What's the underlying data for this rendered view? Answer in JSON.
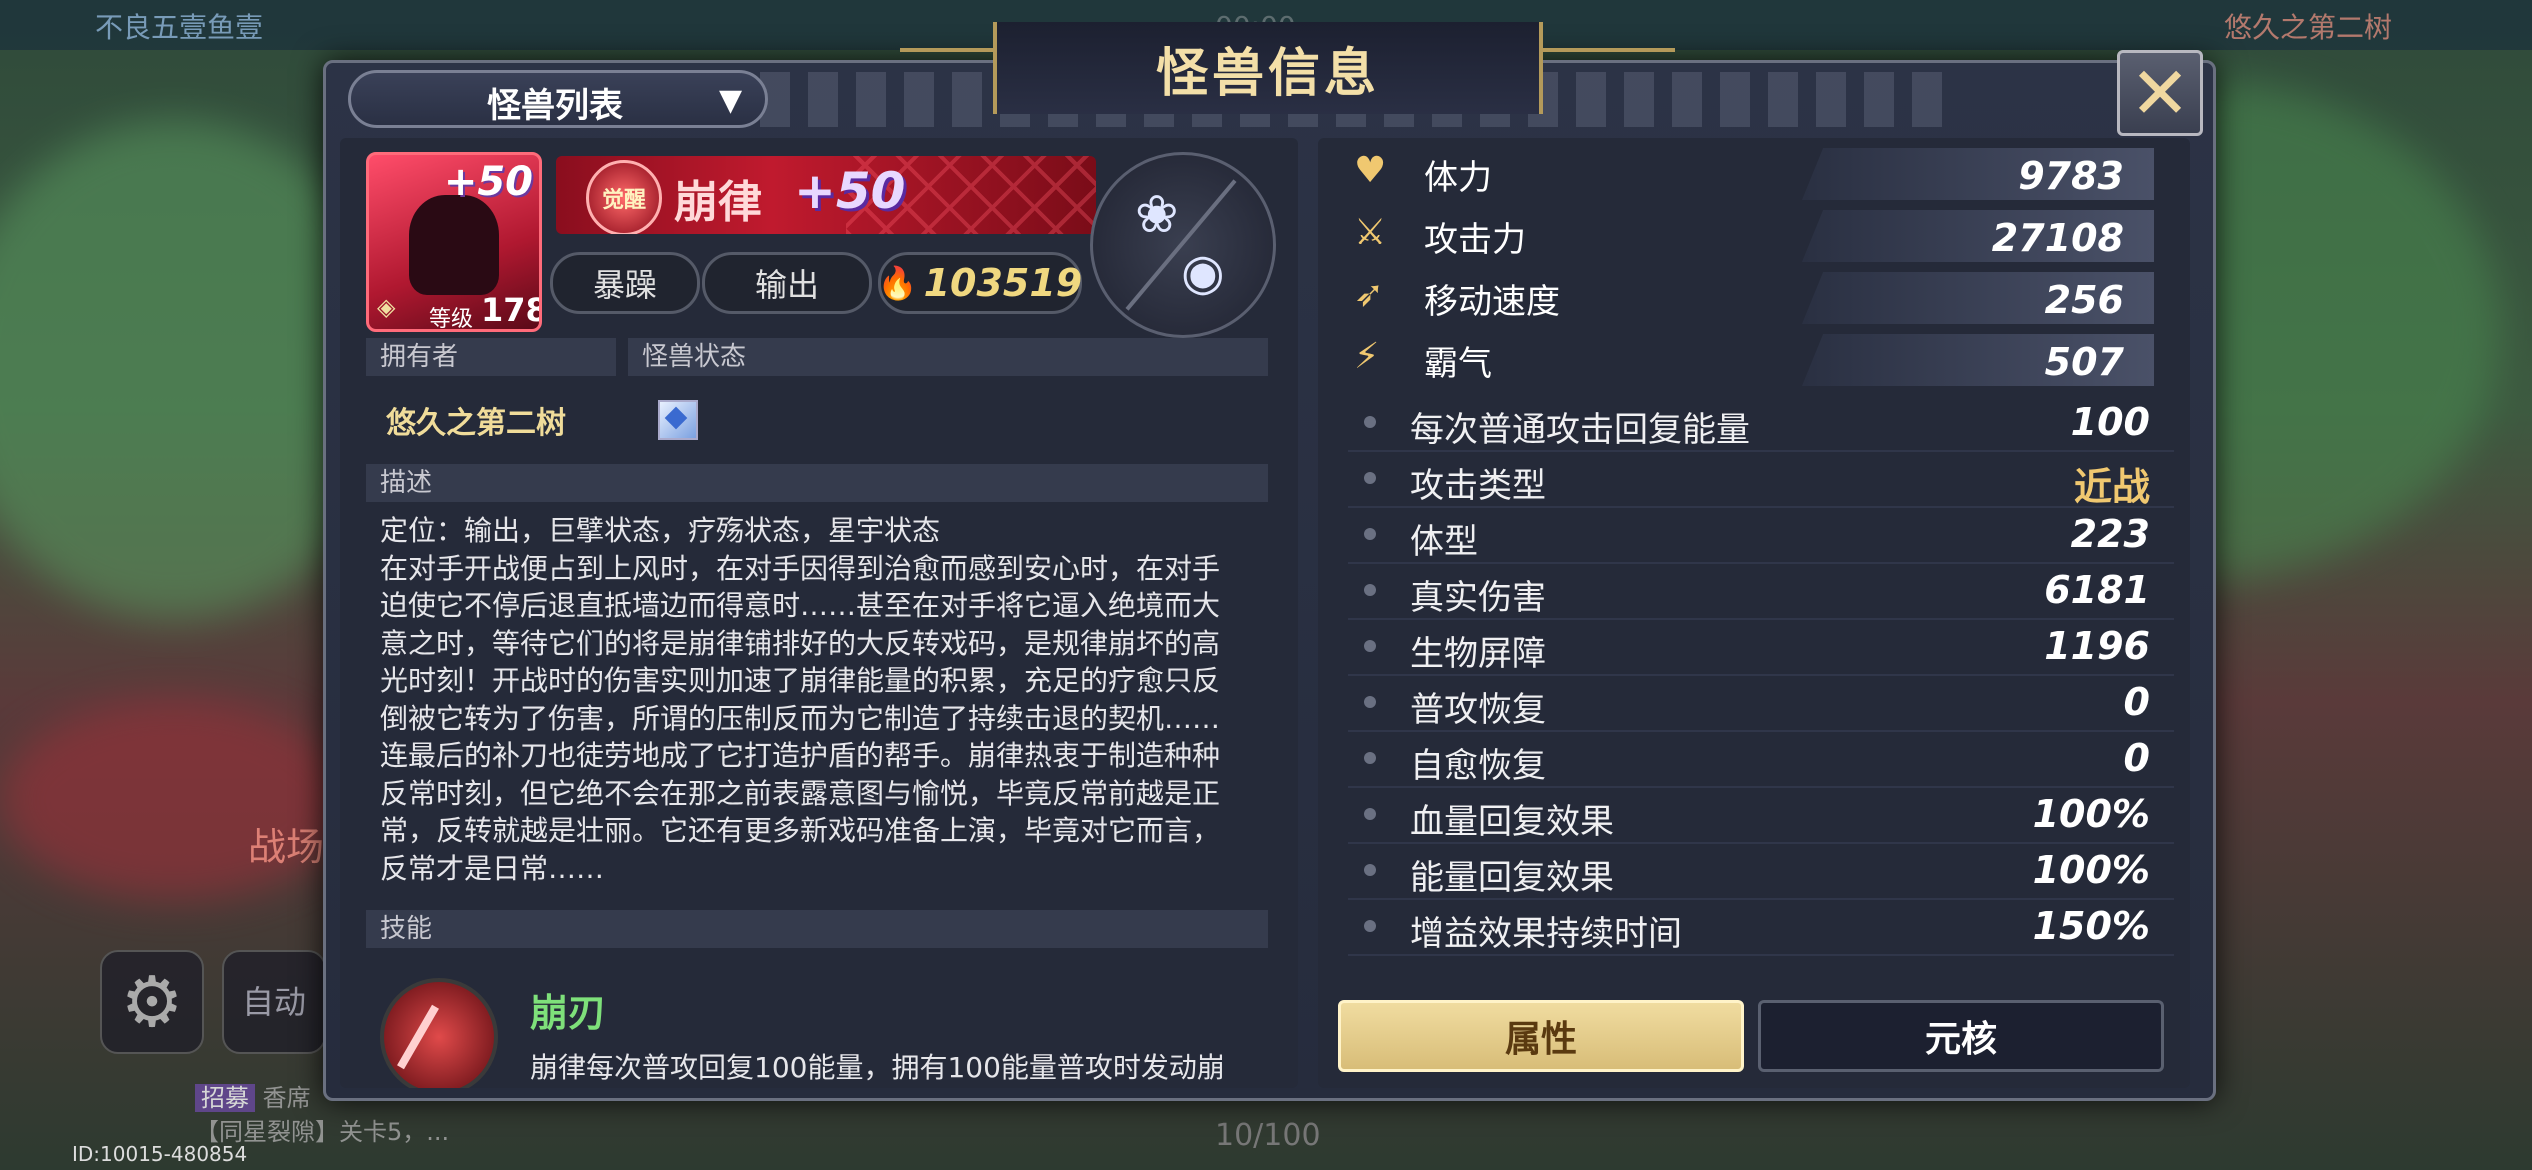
{
  "topbar": {
    "left_text": "不良五壹鱼壹",
    "right_text": "悠久之第二树",
    "center_text": "00:00"
  },
  "dropdown": {
    "label": "怪兽列表"
  },
  "title": "怪兽信息",
  "close_symbol": "✕",
  "monster": {
    "plus": "+50",
    "level_label": "等级",
    "level": "178",
    "awaken_label": "觉醒",
    "name": "崩律",
    "name_plus": "+50",
    "tags": [
      "暴躁",
      "输出"
    ],
    "power": "103519",
    "core_icons": [
      "fox-spirit-icon",
      "orb-spirit-icon"
    ]
  },
  "sections": {
    "owner_label": "拥有者",
    "status_label": "怪兽状态",
    "desc_label": "描述",
    "skill_label": "技能"
  },
  "owner": "悠久之第二树",
  "description": [
    "定位：输出，巨擘状态，疗殇状态，星宇状态",
    "在对手开战便占到上风时，在对手因得到治愈而感到安心时，在对手",
    "迫使它不停后退直抵墙边而得意时……甚至在对手将它逼入绝境而大",
    "意之时，等待它们的将是崩律铺排好的大反转戏码，是规律崩坏的高",
    "光时刻！开战时的伤害实则加速了崩律能量的积累，充足的疗愈只反",
    "倒被它转为了伤害，所谓的压制反而为它制造了持续击退的契机……",
    "连最后的补刀也徒劳地成了它打造护盾的帮手。崩律热衷于制造种种",
    "反常时刻，但它绝不会在那之前表露意图与愉悦，毕竟反常前越是正",
    "常，反转就越是壮丽。它还有更多新戏码准备上演，毕竟对它而言，",
    "反常才是日常……"
  ],
  "skill": {
    "name": "崩刃",
    "desc": "崩律每次普攻回复100能量，拥有100能量普攻时发动崩"
  },
  "main_stats": [
    {
      "label": "体力",
      "value": "9783",
      "icon": "heart-icon"
    },
    {
      "label": "攻击力",
      "value": "27108",
      "icon": "sword-icon"
    },
    {
      "label": "移动速度",
      "value": "256",
      "icon": "boot-icon"
    },
    {
      "label": "霸气",
      "value": "507",
      "icon": "claw-icon"
    }
  ],
  "sub_stats": [
    {
      "label": "每次普通攻击回复能量",
      "value": "100"
    },
    {
      "label": "攻击类型",
      "value": "近战"
    },
    {
      "label": "体型",
      "value": "223"
    },
    {
      "label": "真实伤害",
      "value": "6181"
    },
    {
      "label": "生物屏障",
      "value": "1196"
    },
    {
      "label": "普攻恢复",
      "value": "0"
    },
    {
      "label": "自愈恢复",
      "value": "0"
    },
    {
      "label": "血量回复效果",
      "value": "100%"
    },
    {
      "label": "能量回复效果",
      "value": "100%"
    },
    {
      "label": "增益效果持续时间",
      "value": "150%"
    }
  ],
  "tabs": {
    "attr": "属性",
    "core": "元核"
  },
  "hud": {
    "battle_label": "战场",
    "auto_label": "自动",
    "chat_tag": "招募",
    "chat_1": "香席",
    "chat_2": "【同星裂隙】关卡5，...",
    "progress": "10/100",
    "id_text": "ID:10015-480854"
  },
  "colors": {
    "accent_gold": "#f0c870",
    "panel_bg": "#2c3346",
    "monster_red": "#c01a2e",
    "skill_green": "#7ee07a"
  }
}
